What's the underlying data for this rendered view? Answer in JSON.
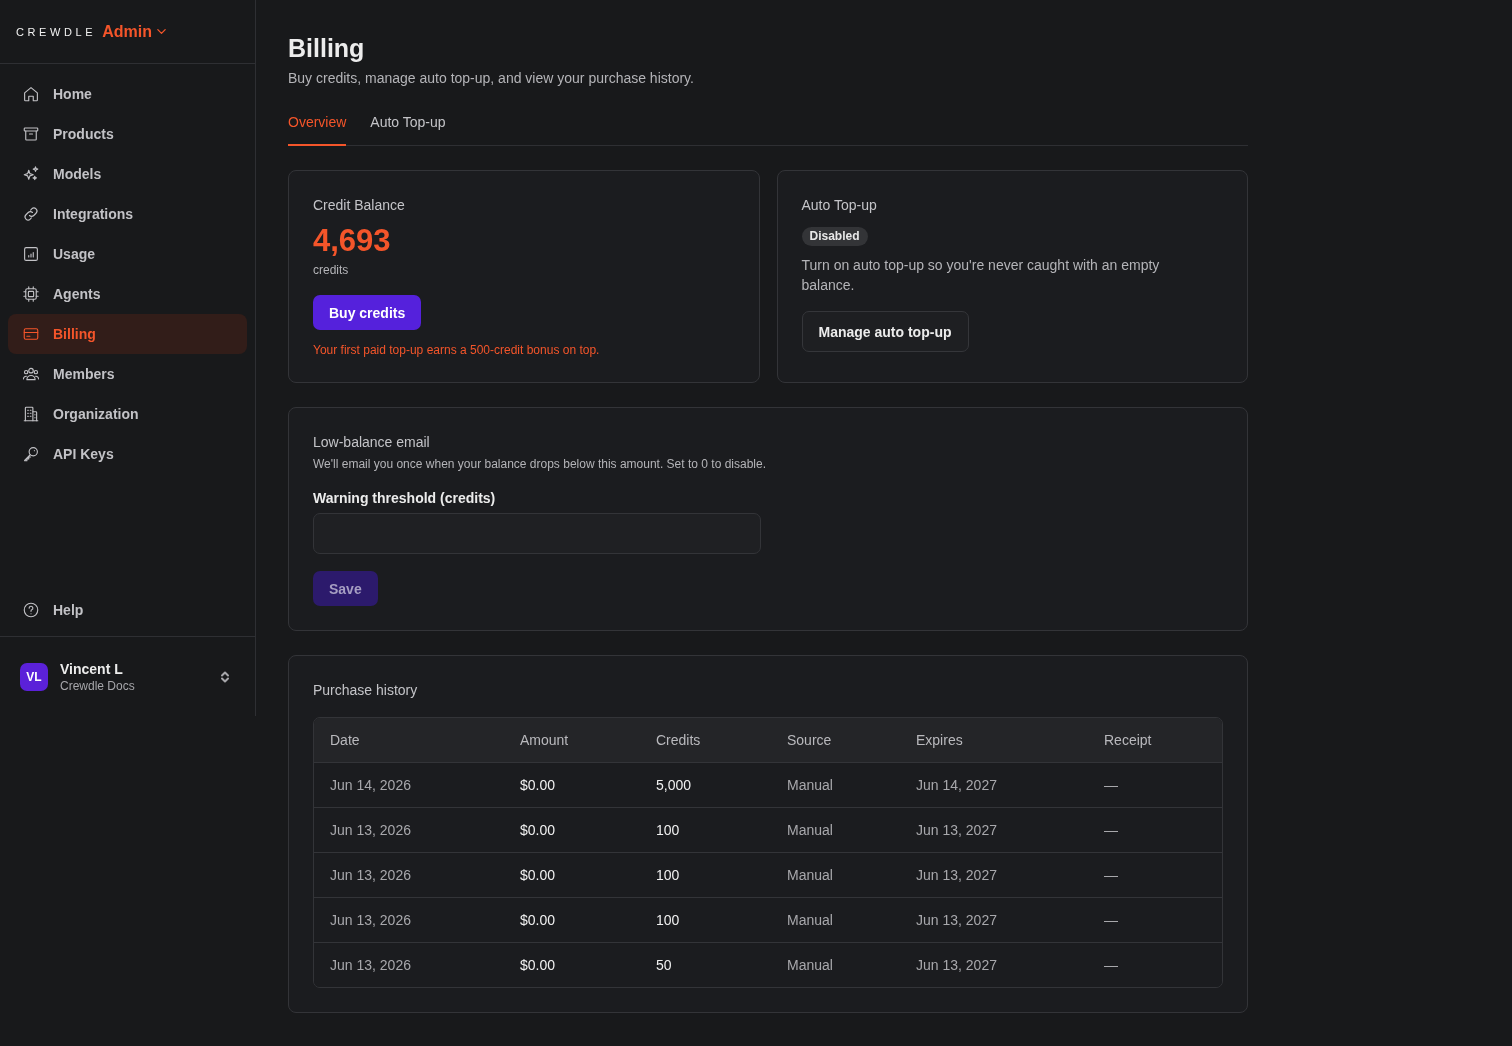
{
  "sidebar": {
    "logo": "CREWDLE",
    "workspace": "Admin",
    "items": [
      {
        "label": "Home",
        "selected": false
      },
      {
        "label": "Products",
        "selected": false
      },
      {
        "label": "Models",
        "selected": false
      },
      {
        "label": "Integrations",
        "selected": false
      },
      {
        "label": "Usage",
        "selected": false
      },
      {
        "label": "Agents",
        "selected": false
      },
      {
        "label": "Billing",
        "selected": true
      },
      {
        "label": "Members",
        "selected": false
      },
      {
        "label": "Organization",
        "selected": false
      },
      {
        "label": "API Keys",
        "selected": false
      }
    ],
    "help": "Help",
    "user": {
      "initials": "VL",
      "name": "Vincent L",
      "org": "Crewdle Docs"
    }
  },
  "page": {
    "title": "Billing",
    "subtitle": "Buy credits, manage auto top-up, and view your purchase history."
  },
  "tabs": [
    {
      "label": "Overview",
      "selected": true
    },
    {
      "label": "Auto Top-up",
      "selected": false
    }
  ],
  "credit_balance": {
    "title": "Credit Balance",
    "amount": "4,693",
    "unit": "credits",
    "button": "Buy credits",
    "note": "Your first paid top-up earns a 500-credit bonus on top."
  },
  "auto_topup": {
    "title": "Auto Top-up",
    "status": "Disabled",
    "enabled": false,
    "description": "Turn on auto top-up so you're never caught with an empty balance.",
    "button": "Manage auto top-up"
  },
  "low_balance_email": {
    "title": "Low-balance email",
    "description": "We'll email you once when your balance drops below this amount. Set to 0 to disable.",
    "field_label": "Warning threshold (credits)",
    "save_button": {
      "label": "Save",
      "disabled": true
    }
  },
  "purchase_history": {
    "title": "Purchase history",
    "columns": [
      "Date",
      "Amount",
      "Credits",
      "Source",
      "Expires",
      "Receipt"
    ],
    "rows": [
      [
        "Jun 14, 2026",
        "$0.00",
        "5,000",
        "Manual",
        "Jun 14, 2027",
        "—"
      ],
      [
        "Jun 13, 2026",
        "$0.00",
        "100",
        "Manual",
        "Jun 13, 2027",
        "—"
      ],
      [
        "Jun 13, 2026",
        "$0.00",
        "100",
        "Manual",
        "Jun 13, 2027",
        "—"
      ],
      [
        "Jun 13, 2026",
        "$0.00",
        "100",
        "Manual",
        "Jun 13, 2027",
        "—"
      ],
      [
        "Jun 13, 2026",
        "$0.00",
        "50",
        "Manual",
        "Jun 13, 2027",
        "—"
      ]
    ]
  }
}
